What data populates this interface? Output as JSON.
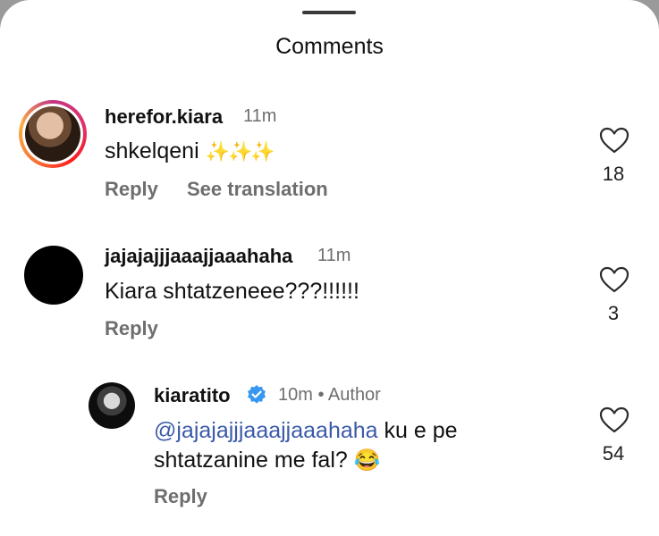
{
  "header": {
    "title": "Comments"
  },
  "comments": [
    {
      "username": "herefor.kiara",
      "time": "11m",
      "text": "shkelqeni",
      "emoji": "✨✨✨",
      "actions": {
        "reply": "Reply",
        "translate": "See translation"
      },
      "likes": "18"
    },
    {
      "username": "jajajajjjaaajjaaahaha",
      "time": "11m",
      "text": "Kiara shtatzeneee???!!!!!!",
      "actions": {
        "reply": "Reply"
      },
      "likes": "3"
    },
    {
      "username": "kiaratito",
      "verified": true,
      "meta": "10m • Author",
      "mention": "@jajajajjjaaajjaaahaha",
      "text_line1": " ku e pe",
      "text_line2": "shtatzanine me fal? ",
      "emoji": "😂",
      "actions": {
        "reply": "Reply"
      },
      "likes": "54"
    }
  ],
  "colors": {
    "verified": "#3897f0",
    "mention": "#3b5aa8",
    "secondary_text": "#6e6e6e"
  },
  "icons": [
    "heart-icon",
    "verified-badge-icon"
  ]
}
